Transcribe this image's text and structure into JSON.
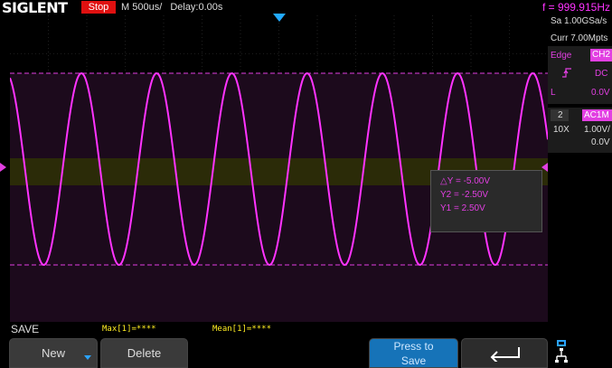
{
  "header": {
    "brand": "SIGLENT",
    "run_state": "Stop",
    "timebase": "M 500us/",
    "delay": "Delay:0.00s",
    "frequency": "f = 999.915Hz"
  },
  "right_panel": {
    "sample_rate": "Sa 1.00GSa/s",
    "memory_depth": "Curr 7.00Mpts",
    "trigger_type": "Edge",
    "trigger_source": "CH2",
    "trigger_coupling": "DC",
    "trigger_level_prefix": "L",
    "trigger_level": "0.0V",
    "channel_number": "2",
    "channel_coupling": "AC1M",
    "probe": "10X",
    "volts_per_div": "1.00V/",
    "offset": "0.0V"
  },
  "cursors": {
    "delta_y": "△Y = -5.00V",
    "y2": "Y2 = -2.50V",
    "y1": "Y1 = 2.50V"
  },
  "status": {
    "menu": "SAVE",
    "measure_max": "Max[1]=****",
    "measure_mean": "Mean[1]=****"
  },
  "softkeys": {
    "new": "New",
    "delete": "Delete",
    "press_line1": "Press to",
    "press_line2": "Save"
  },
  "colors": {
    "ch2": "#e23fe2",
    "ch1": "#c8c820",
    "stop": "#e01010",
    "trigger_marker": "#22aaff",
    "active_softkey": "#1673b8"
  },
  "icons": {
    "return": "return-arrow-icon",
    "network": "network-icon",
    "softkey_more": "triangle-down-icon"
  },
  "waveform": {
    "visible_cycles": 7,
    "volts_per_div": 1.0,
    "peak_volts": 2.5
  }
}
